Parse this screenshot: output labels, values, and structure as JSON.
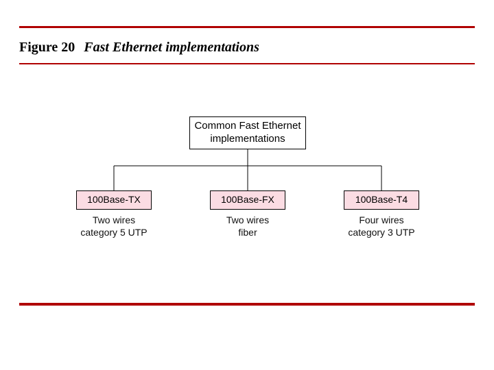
{
  "caption": {
    "figure_label": "Figure 20",
    "title": "Fast Ethernet implementations"
  },
  "diagram": {
    "root": "Common Fast Ethernet implementations",
    "children": [
      {
        "name": "100Base-TX",
        "desc_line1": "Two wires",
        "desc_line2": "category 5 UTP"
      },
      {
        "name": "100Base-FX",
        "desc_line1": "Two wires",
        "desc_line2": "fiber"
      },
      {
        "name": "100Base-T4",
        "desc_line1": "Four wires",
        "desc_line2": "category 3 UTP"
      }
    ]
  }
}
